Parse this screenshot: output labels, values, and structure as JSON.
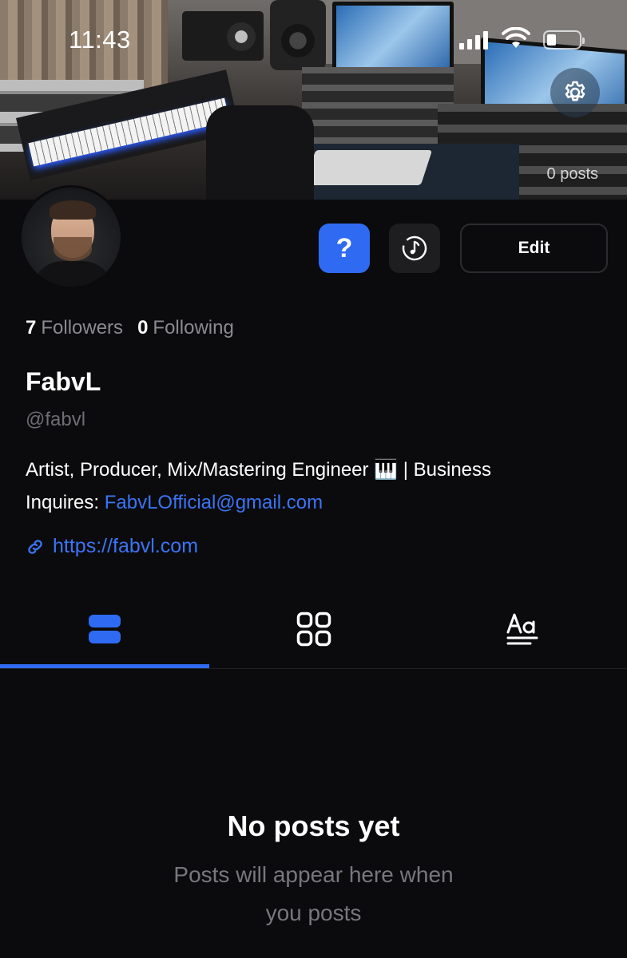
{
  "status_bar": {
    "time": "11:43"
  },
  "header": {
    "posts_count": "0 posts",
    "settings_icon": "gear-icon"
  },
  "profile": {
    "followers_count": "7",
    "followers_label": "Followers",
    "following_count": "0",
    "following_label": "Following",
    "display_name": "FabvL",
    "handle": "@fabvl",
    "bio_line1": "Artist, Producer, Mix/Mastering Engineer 🎹 | Business",
    "bio_line2_prefix": "Inquires: ",
    "bio_email": "FabvLOfficial@gmail.com",
    "website": "https://fabvl.com"
  },
  "actions": {
    "help_label": "?",
    "edit_label": "Edit",
    "music_icon": "music-note-icon"
  },
  "tabs": [
    {
      "icon": "list-view-icon",
      "active": true
    },
    {
      "icon": "grid-view-icon",
      "active": false
    },
    {
      "icon": "text-view-icon",
      "active": false
    }
  ],
  "empty_state": {
    "title": "No posts yet",
    "subtitle_line1": "Posts will appear here when",
    "subtitle_line2": "you posts"
  },
  "colors": {
    "accent": "#2f6bf2",
    "background": "#0b0b0d",
    "muted_text": "#8a8a90"
  }
}
